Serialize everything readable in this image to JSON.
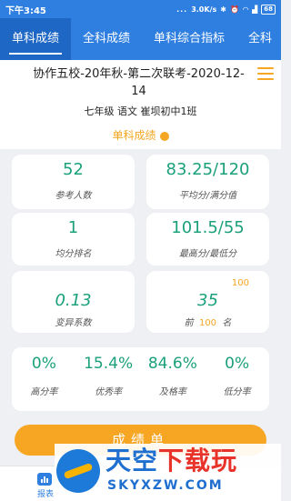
{
  "status_bar": {
    "time": "下午3:45",
    "signal_dots": "...",
    "speed": "3.0K/s",
    "battery": "68"
  },
  "tabs": [
    {
      "label": "单科成绩",
      "active": true
    },
    {
      "label": "全科成绩",
      "active": false
    },
    {
      "label": "单科综合指标",
      "active": false
    },
    {
      "label": "全科",
      "active": false
    }
  ],
  "header": {
    "exam_title": "协作五校-20年秋-第二次联考-2020-12-14",
    "class_line": "七年级 语文 崔坝初中1班",
    "section_title": "单科成绩"
  },
  "stats": {
    "participants": {
      "value": "52",
      "label": "参考人数"
    },
    "avg_full": {
      "value": "83.25/120",
      "label": "平均分/满分值"
    },
    "avg_rank": {
      "value": "1",
      "label": "均分排名"
    },
    "max_min": {
      "value": "101.5/55",
      "label": "最高分/最低分"
    },
    "variation": {
      "value": "0.13",
      "label": "变异系数"
    },
    "top_rank": {
      "value": "35",
      "superscript": "100",
      "label_prefix": "前",
      "label_highlight": "100",
      "label_suffix": "名"
    }
  },
  "rates": [
    {
      "value": "0%",
      "label": "高分率"
    },
    {
      "value": "15.4%",
      "label": "优秀率"
    },
    {
      "value": "84.6%",
      "label": "及格率"
    },
    {
      "value": "0%",
      "label": "低分率"
    }
  ],
  "report_button": "成绩单",
  "bottom_nav": {
    "label": "报表"
  },
  "watermark": {
    "cn_main": "天空",
    "cn_hot": "下载玩",
    "en": "SKYXZW.COM"
  },
  "colors": {
    "primary": "#2f7fe0",
    "accent": "#f5a623",
    "value": "#1aa07a"
  }
}
